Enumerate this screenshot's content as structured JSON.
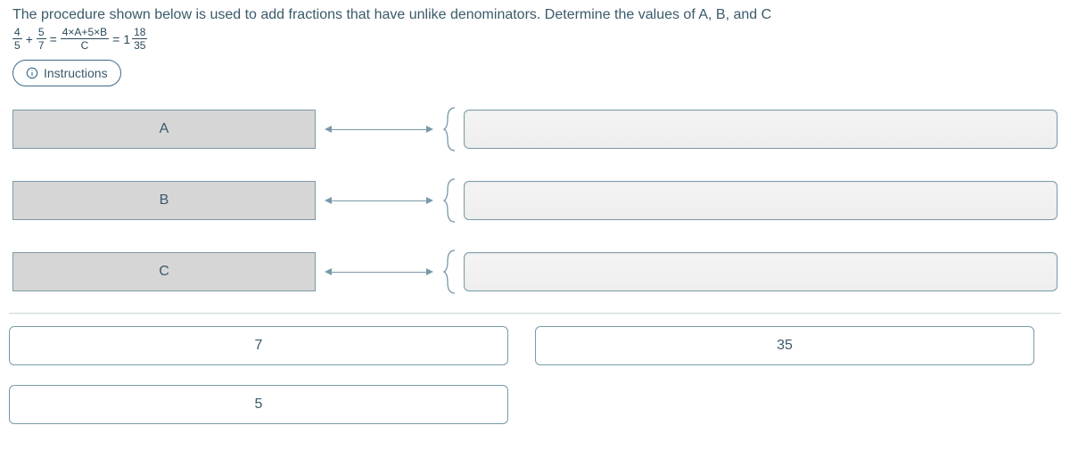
{
  "prompt": "The procedure shown below is used to add fractions that have unlike denominators. Determine the values of A, B, and C",
  "equation": {
    "f1": {
      "num": "4",
      "den": "5"
    },
    "plus": "+",
    "f2": {
      "num": "5",
      "den": "7"
    },
    "eq1": "=",
    "f3": {
      "num": "4×A+5×B",
      "den": "C"
    },
    "eq2": "=",
    "mixed": {
      "whole": "1",
      "num": "18",
      "den": "35"
    }
  },
  "instructions_label": "Instructions",
  "slots": [
    {
      "label": "A"
    },
    {
      "label": "B"
    },
    {
      "label": "C"
    }
  ],
  "tiles": {
    "row1": [
      "7",
      "35"
    ],
    "row2": [
      "5"
    ]
  }
}
